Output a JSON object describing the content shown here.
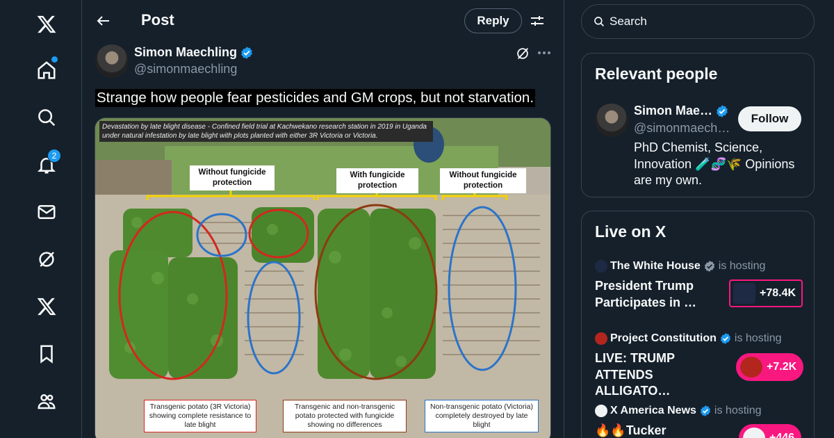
{
  "colors": {
    "accent": "#1d9bf0",
    "live": "#f91880",
    "background": "#15202b",
    "border": "#38444d"
  },
  "nav": {
    "items": [
      {
        "icon": "x-logo-icon"
      },
      {
        "icon": "home-icon"
      },
      {
        "icon": "explore-icon"
      },
      {
        "icon": "notifications-icon",
        "badge": "2"
      },
      {
        "icon": "messages-icon"
      },
      {
        "icon": "grok-icon"
      },
      {
        "icon": "x-premium-icon"
      },
      {
        "icon": "bookmarks-icon"
      },
      {
        "icon": "communities-icon"
      }
    ]
  },
  "header": {
    "title": "Post",
    "reply_label": "Reply"
  },
  "post": {
    "author_name": "Simon Maechling",
    "author_handle": "@simonmaechling",
    "text": "Strange how people fear pesticides and GM crops, but not starvation.",
    "image": {
      "caption": "Devastation by late blight disease - Confined field trial at Kachwekano research station in 2019 in Uganda under natural infestation by late blight with plots planted with either 3R Victoria or Victoria.",
      "labels": [
        "Without fungicide protection",
        "With fungicide protection",
        "Without fungicide protection"
      ],
      "bottom_labels": [
        "Transgenic potato (3R Victoria) showing complete resistance to late blight",
        "Transgenic and non-transgenic potato protected with fungicide showing no differences",
        "Non-transgenic potato (Victoria) completely destroyed by late blight"
      ]
    }
  },
  "search": {
    "placeholder": "Search"
  },
  "relevant_people": {
    "title": "Relevant people",
    "name": "Simon Mae…",
    "handle": "@simonmaech…",
    "follow_label": "Follow",
    "bio": "PhD Chemist, Science, Innovation 🧪🧬🌾 Opinions are my own."
  },
  "live": {
    "title": "Live on X",
    "hosting_label": "is hosting",
    "items": [
      {
        "host": "The White House",
        "title": "President Trump Participates in …",
        "count": "+78.4K"
      },
      {
        "host": "Project Constitution",
        "title": "LIVE: TRUMP ATTENDS ALLIGATO…",
        "count": "+7.2K"
      },
      {
        "host": "X America News",
        "title": "🔥🔥Tucker Carlson's",
        "count": "+446"
      }
    ]
  }
}
